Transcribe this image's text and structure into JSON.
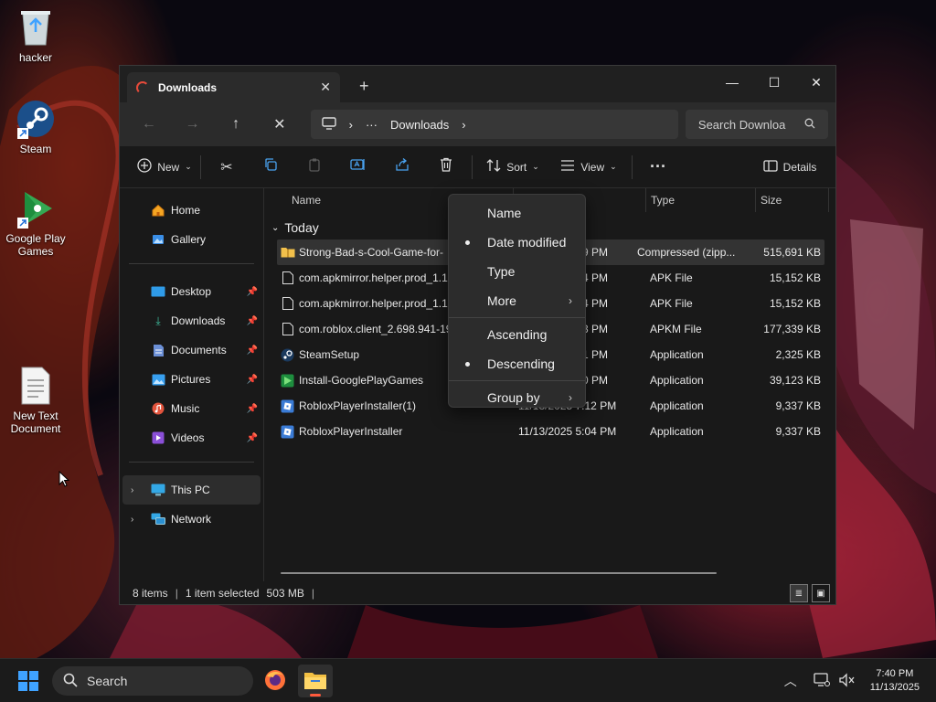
{
  "desktop": {
    "icons": [
      {
        "label": "hacker"
      },
      {
        "label": "Steam"
      },
      {
        "label": "Google Play Games"
      },
      {
        "label": "New Text Document"
      }
    ]
  },
  "window": {
    "tab_title": "Downloads",
    "new_tab_symbol": "+",
    "address": {
      "ellipsis": "···",
      "current": "Downloads"
    },
    "search_placeholder": "Search Downloa",
    "toolbar": {
      "new_label": "New",
      "sort_label": "Sort",
      "view_label": "View",
      "more_label": "···",
      "details_label": "Details"
    },
    "sidebar": {
      "top": [
        {
          "label": "Home"
        },
        {
          "label": "Gallery"
        }
      ],
      "quick": [
        {
          "label": "Desktop"
        },
        {
          "label": "Downloads"
        },
        {
          "label": "Documents"
        },
        {
          "label": "Pictures"
        },
        {
          "label": "Music"
        },
        {
          "label": "Videos"
        }
      ],
      "tree": [
        {
          "label": "This PC"
        },
        {
          "label": "Network"
        }
      ]
    },
    "columns": {
      "name": "Name",
      "type": "Type",
      "size": "Size"
    },
    "group_label": "Today",
    "files": [
      {
        "name": "Strong-Bad-s-Cool-Game-for-",
        "date": "9 PM",
        "type": "Compressed (zipp...",
        "size": "515,691 KB"
      },
      {
        "name": "com.apkmirror.helper.prod_1.1",
        "date": "4 PM",
        "type": "APK File",
        "size": "15,152 KB"
      },
      {
        "name": "com.apkmirror.helper.prod_1.1",
        "date": "4 PM",
        "type": "APK File",
        "size": "15,152 KB"
      },
      {
        "name": "com.roblox.client_2.698.941-19",
        "date": "3 PM",
        "type": "APKM File",
        "size": "177,339 KB"
      },
      {
        "name": "SteamSetup",
        "date": "1 PM",
        "type": "Application",
        "size": "2,325 KB"
      },
      {
        "name": "Install-GooglePlayGames",
        "date": "0 PM",
        "type": "Application",
        "size": "39,123 KB"
      },
      {
        "name": "RobloxPlayerInstaller(1)",
        "date": "11/13/2025 7:12 PM",
        "type": "Application",
        "size": "9,337 KB"
      },
      {
        "name": "RobloxPlayerInstaller",
        "date": "11/13/2025 5:04 PM",
        "type": "Application",
        "size": "9,337 KB"
      }
    ],
    "status": {
      "items": "8 items",
      "selected": "1 item selected",
      "selected_size": "503 MB"
    }
  },
  "sort_menu": {
    "items": [
      {
        "label": "Name"
      },
      {
        "label": "Date modified",
        "checked": true
      },
      {
        "label": "Type"
      },
      {
        "label": "More",
        "submenu": true
      },
      {
        "label": "Ascending"
      },
      {
        "label": "Descending",
        "checked": true
      },
      {
        "label": "Group by",
        "submenu": true
      }
    ]
  },
  "taskbar": {
    "search_placeholder": "Search",
    "time": "7:40 PM",
    "date": "11/13/2025"
  }
}
